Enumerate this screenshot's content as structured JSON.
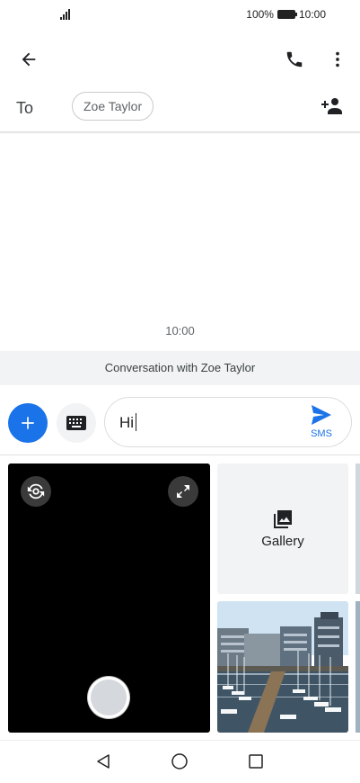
{
  "status_bar": {
    "battery": "100%",
    "time": "10:00"
  },
  "recipient": {
    "to_label": "To",
    "name": "Zoe Taylor"
  },
  "conversation": {
    "timestamp": "10:00",
    "banner": "Conversation with Zoe Taylor"
  },
  "compose": {
    "text": "Hi",
    "send_type": "SMS"
  },
  "media": {
    "gallery_label": "Gallery"
  },
  "colors": {
    "accent": "#1a73e8",
    "chip_border": "#c8cacd",
    "banner_bg": "#f1f3f4"
  },
  "icons": [
    "back-arrow-icon",
    "phone-icon",
    "more-vert-icon",
    "add-contact-icon",
    "plus-icon",
    "keyboard-icon",
    "send-icon",
    "camera-switch-icon",
    "fullscreen-icon",
    "gallery-icon",
    "nav-back-icon",
    "nav-home-icon",
    "nav-recents-icon"
  ]
}
